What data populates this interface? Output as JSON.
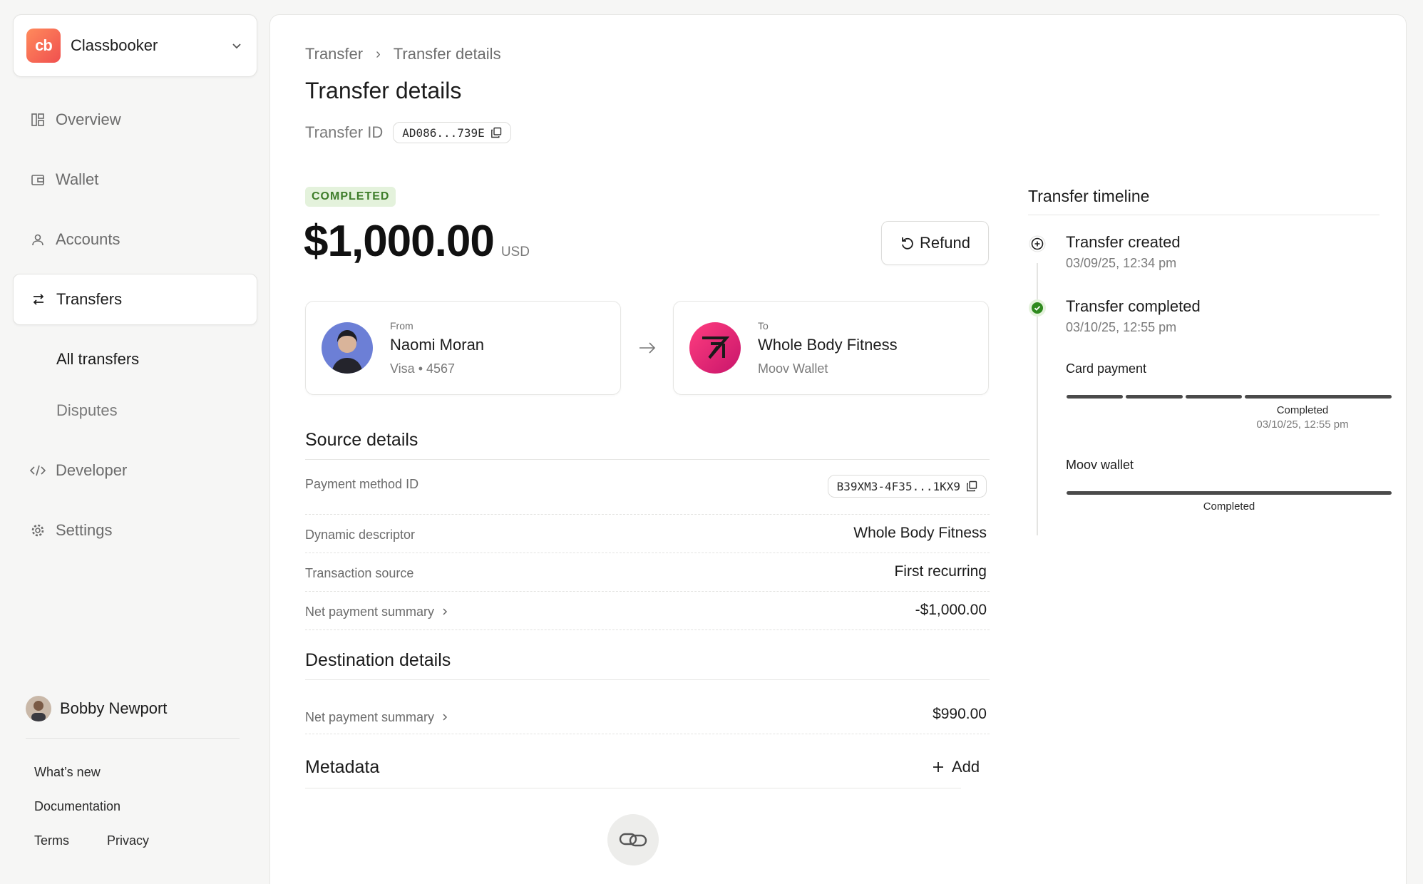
{
  "sidebar": {
    "org_name": "Classbooker",
    "org_logo_text": "cb",
    "nav": {
      "overview": "Overview",
      "wallet": "Wallet",
      "accounts": "Accounts",
      "transfers": "Transfers",
      "developer": "Developer",
      "settings": "Settings"
    },
    "sub": {
      "all_transfers": "All transfers",
      "disputes": "Disputes"
    },
    "user_name": "Bobby Newport",
    "footer": {
      "whats_new": "What’s new",
      "documentation": "Documentation",
      "terms": "Terms",
      "privacy": "Privacy"
    }
  },
  "breadcrumb": {
    "parent": "Transfer",
    "separator": "›",
    "current": "Transfer details"
  },
  "page_title": "Transfer details",
  "transfer_id": {
    "label": "Transfer ID",
    "value": "AD086...739E"
  },
  "status": "COMPLETED",
  "amount": {
    "value": "$1,000.00",
    "currency": "USD"
  },
  "refund_label": "Refund",
  "from": {
    "role": "From",
    "name": "Naomi Moran",
    "sub": "Visa • 4567"
  },
  "to": {
    "role": "To",
    "name": "Whole Body Fitness",
    "sub": "Moov Wallet"
  },
  "source": {
    "title": "Source details",
    "rows": [
      {
        "label": "Payment method ID",
        "value": "B39XM3-4F35...1KX9"
      },
      {
        "label": "Dynamic descriptor",
        "value": "Whole Body Fitness"
      },
      {
        "label": "Transaction source",
        "value": "First recurring"
      },
      {
        "label": "Net payment summary",
        "value": "-$1,000.00"
      }
    ]
  },
  "destination": {
    "title": "Destination details",
    "rows": [
      {
        "label": "Net payment summary",
        "value": "$990.00"
      }
    ]
  },
  "metadata": {
    "title": "Metadata",
    "add_label": "Add"
  },
  "timeline": {
    "title": "Transfer timeline",
    "events": [
      {
        "name": "Transfer created",
        "date": "03/09/25, 12:34 pm"
      },
      {
        "name": "Transfer completed",
        "date": "03/10/25, 12:55 pm"
      }
    ],
    "card_payment": {
      "label": "Card payment",
      "status": "Completed",
      "date": "03/10/25, 12:55 pm"
    },
    "moov_wallet": {
      "label": "Moov wallet",
      "status": "Completed"
    }
  },
  "colors": {
    "brand": "#f0504f",
    "success": "#2f8a1e",
    "badge_bg": "#e4f2dc"
  },
  "icons": [
    "chevron-down-icon",
    "overview-icon",
    "wallet-icon",
    "accounts-icon",
    "transfers-icon",
    "developer-icon",
    "settings-icon",
    "copy-icon",
    "refund-icon",
    "arrow-right-icon",
    "chevron-right-icon",
    "plus-icon",
    "link-icon",
    "plus-circle-icon",
    "check-circle-icon"
  ]
}
